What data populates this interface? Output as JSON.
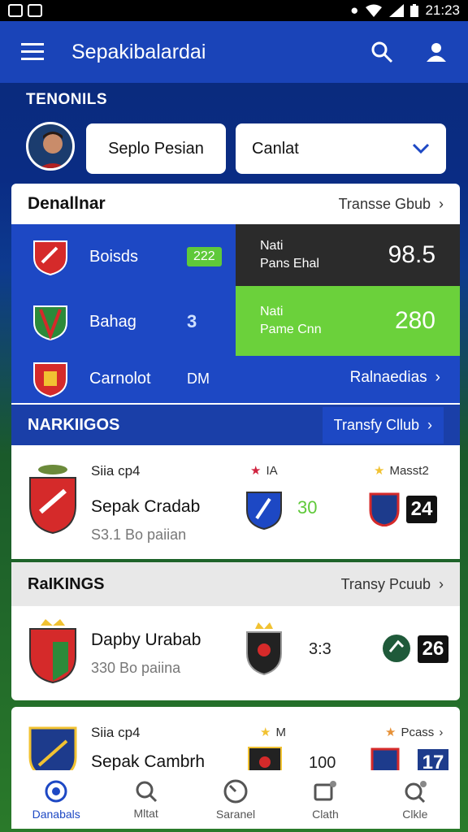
{
  "status": {
    "time": "21:23"
  },
  "appbar": {
    "title": "Sepakibalardai"
  },
  "section_label": "TENONILS",
  "filters": {
    "pill1": "Seplo Pesian",
    "pill2": "Canlat"
  },
  "card1": {
    "heading": "Denallnar",
    "link": "Transse Gbub",
    "rows": [
      {
        "name": "Boisds",
        "badge": "222"
      },
      {
        "name": "Bahag",
        "badge": "3"
      },
      {
        "name": "Carnolot",
        "badge": "DM"
      }
    ],
    "stat_dark": {
      "line1": "Nati",
      "line2": "Pans Ehal",
      "value": "98.5"
    },
    "stat_green": {
      "line1": "Nati",
      "line2": "Pame Cnn",
      "value": "280"
    },
    "bottom_link": "Ralnaedias"
  },
  "rankings1": {
    "heading": "NARKIIGOS",
    "link": "Transfy Cllub",
    "match": {
      "title": "Siia cp4",
      "name": "Sepak Cradab",
      "sub": "S3.1 Bo paiian",
      "mid_label": "IA",
      "mid_score": "30",
      "right_label": "Masst2",
      "right_badge": "24"
    }
  },
  "rankings2": {
    "heading": "RaIKINGS",
    "link": "Transy Pcuub",
    "match": {
      "name": "Dapby Urabab",
      "sub": "330 Bo paiina",
      "mid_score": "3:3",
      "right_badge": "26"
    }
  },
  "rankings3": {
    "match": {
      "title": "Siia cp4",
      "name": "Sepak Cambrh",
      "mid_label": "M",
      "mid_score": "100",
      "right_label": "Pcass",
      "right_badge": "17"
    }
  },
  "bottom_nav": [
    {
      "label": "Danabals",
      "icon": "home-icon"
    },
    {
      "label": "Mltat",
      "icon": "search-icon"
    },
    {
      "label": "Saranel",
      "icon": "gauge-icon"
    },
    {
      "label": "Clath",
      "icon": "chat-icon"
    },
    {
      "label": "Clkle",
      "icon": "profile-search-icon"
    }
  ],
  "colors": {
    "appbar": "#1a44b8",
    "panel": "#1d48c4",
    "green": "#6bd13b",
    "dark": "#2b2b2b"
  }
}
